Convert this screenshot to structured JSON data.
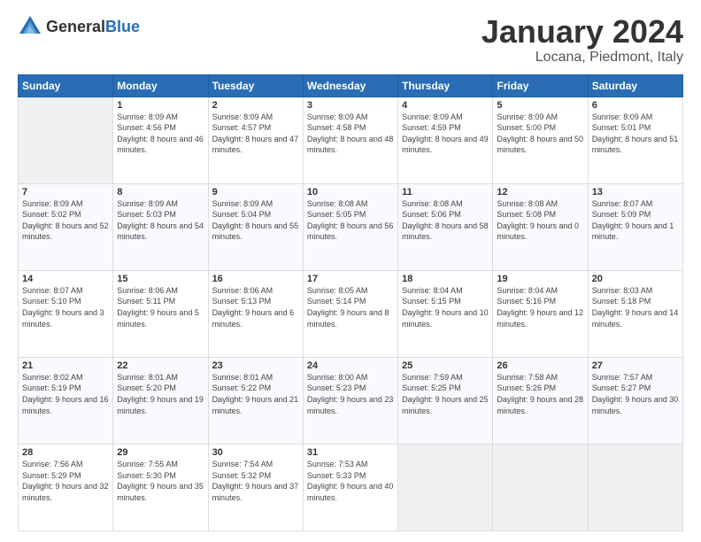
{
  "logo": {
    "general": "General",
    "blue": "Blue"
  },
  "header": {
    "month": "January 2024",
    "location": "Locana, Piedmont, Italy"
  },
  "days_header": [
    "Sunday",
    "Monday",
    "Tuesday",
    "Wednesday",
    "Thursday",
    "Friday",
    "Saturday"
  ],
  "weeks": [
    [
      {
        "num": "",
        "empty": true
      },
      {
        "num": "1",
        "sunrise": "Sunrise: 8:09 AM",
        "sunset": "Sunset: 4:56 PM",
        "daylight": "Daylight: 8 hours and 46 minutes."
      },
      {
        "num": "2",
        "sunrise": "Sunrise: 8:09 AM",
        "sunset": "Sunset: 4:57 PM",
        "daylight": "Daylight: 8 hours and 47 minutes."
      },
      {
        "num": "3",
        "sunrise": "Sunrise: 8:09 AM",
        "sunset": "Sunset: 4:58 PM",
        "daylight": "Daylight: 8 hours and 48 minutes."
      },
      {
        "num": "4",
        "sunrise": "Sunrise: 8:09 AM",
        "sunset": "Sunset: 4:59 PM",
        "daylight": "Daylight: 8 hours and 49 minutes."
      },
      {
        "num": "5",
        "sunrise": "Sunrise: 8:09 AM",
        "sunset": "Sunset: 5:00 PM",
        "daylight": "Daylight: 8 hours and 50 minutes."
      },
      {
        "num": "6",
        "sunrise": "Sunrise: 8:09 AM",
        "sunset": "Sunset: 5:01 PM",
        "daylight": "Daylight: 8 hours and 51 minutes."
      }
    ],
    [
      {
        "num": "7",
        "sunrise": "Sunrise: 8:09 AM",
        "sunset": "Sunset: 5:02 PM",
        "daylight": "Daylight: 8 hours and 52 minutes."
      },
      {
        "num": "8",
        "sunrise": "Sunrise: 8:09 AM",
        "sunset": "Sunset: 5:03 PM",
        "daylight": "Daylight: 8 hours and 54 minutes."
      },
      {
        "num": "9",
        "sunrise": "Sunrise: 8:09 AM",
        "sunset": "Sunset: 5:04 PM",
        "daylight": "Daylight: 8 hours and 55 minutes."
      },
      {
        "num": "10",
        "sunrise": "Sunrise: 8:08 AM",
        "sunset": "Sunset: 5:05 PM",
        "daylight": "Daylight: 8 hours and 56 minutes."
      },
      {
        "num": "11",
        "sunrise": "Sunrise: 8:08 AM",
        "sunset": "Sunset: 5:06 PM",
        "daylight": "Daylight: 8 hours and 58 minutes."
      },
      {
        "num": "12",
        "sunrise": "Sunrise: 8:08 AM",
        "sunset": "Sunset: 5:08 PM",
        "daylight": "Daylight: 9 hours and 0 minutes."
      },
      {
        "num": "13",
        "sunrise": "Sunrise: 8:07 AM",
        "sunset": "Sunset: 5:09 PM",
        "daylight": "Daylight: 9 hours and 1 minute."
      }
    ],
    [
      {
        "num": "14",
        "sunrise": "Sunrise: 8:07 AM",
        "sunset": "Sunset: 5:10 PM",
        "daylight": "Daylight: 9 hours and 3 minutes."
      },
      {
        "num": "15",
        "sunrise": "Sunrise: 8:06 AM",
        "sunset": "Sunset: 5:11 PM",
        "daylight": "Daylight: 9 hours and 5 minutes."
      },
      {
        "num": "16",
        "sunrise": "Sunrise: 8:06 AM",
        "sunset": "Sunset: 5:13 PM",
        "daylight": "Daylight: 9 hours and 6 minutes."
      },
      {
        "num": "17",
        "sunrise": "Sunrise: 8:05 AM",
        "sunset": "Sunset: 5:14 PM",
        "daylight": "Daylight: 9 hours and 8 minutes."
      },
      {
        "num": "18",
        "sunrise": "Sunrise: 8:04 AM",
        "sunset": "Sunset: 5:15 PM",
        "daylight": "Daylight: 9 hours and 10 minutes."
      },
      {
        "num": "19",
        "sunrise": "Sunrise: 8:04 AM",
        "sunset": "Sunset: 5:16 PM",
        "daylight": "Daylight: 9 hours and 12 minutes."
      },
      {
        "num": "20",
        "sunrise": "Sunrise: 8:03 AM",
        "sunset": "Sunset: 5:18 PM",
        "daylight": "Daylight: 9 hours and 14 minutes."
      }
    ],
    [
      {
        "num": "21",
        "sunrise": "Sunrise: 8:02 AM",
        "sunset": "Sunset: 5:19 PM",
        "daylight": "Daylight: 9 hours and 16 minutes."
      },
      {
        "num": "22",
        "sunrise": "Sunrise: 8:01 AM",
        "sunset": "Sunset: 5:20 PM",
        "daylight": "Daylight: 9 hours and 19 minutes."
      },
      {
        "num": "23",
        "sunrise": "Sunrise: 8:01 AM",
        "sunset": "Sunset: 5:22 PM",
        "daylight": "Daylight: 9 hours and 21 minutes."
      },
      {
        "num": "24",
        "sunrise": "Sunrise: 8:00 AM",
        "sunset": "Sunset: 5:23 PM",
        "daylight": "Daylight: 9 hours and 23 minutes."
      },
      {
        "num": "25",
        "sunrise": "Sunrise: 7:59 AM",
        "sunset": "Sunset: 5:25 PM",
        "daylight": "Daylight: 9 hours and 25 minutes."
      },
      {
        "num": "26",
        "sunrise": "Sunrise: 7:58 AM",
        "sunset": "Sunset: 5:26 PM",
        "daylight": "Daylight: 9 hours and 28 minutes."
      },
      {
        "num": "27",
        "sunrise": "Sunrise: 7:57 AM",
        "sunset": "Sunset: 5:27 PM",
        "daylight": "Daylight: 9 hours and 30 minutes."
      }
    ],
    [
      {
        "num": "28",
        "sunrise": "Sunrise: 7:56 AM",
        "sunset": "Sunset: 5:29 PM",
        "daylight": "Daylight: 9 hours and 32 minutes."
      },
      {
        "num": "29",
        "sunrise": "Sunrise: 7:55 AM",
        "sunset": "Sunset: 5:30 PM",
        "daylight": "Daylight: 9 hours and 35 minutes."
      },
      {
        "num": "30",
        "sunrise": "Sunrise: 7:54 AM",
        "sunset": "Sunset: 5:32 PM",
        "daylight": "Daylight: 9 hours and 37 minutes."
      },
      {
        "num": "31",
        "sunrise": "Sunrise: 7:53 AM",
        "sunset": "Sunset: 5:33 PM",
        "daylight": "Daylight: 9 hours and 40 minutes."
      },
      {
        "num": "",
        "empty": true
      },
      {
        "num": "",
        "empty": true
      },
      {
        "num": "",
        "empty": true
      }
    ]
  ]
}
